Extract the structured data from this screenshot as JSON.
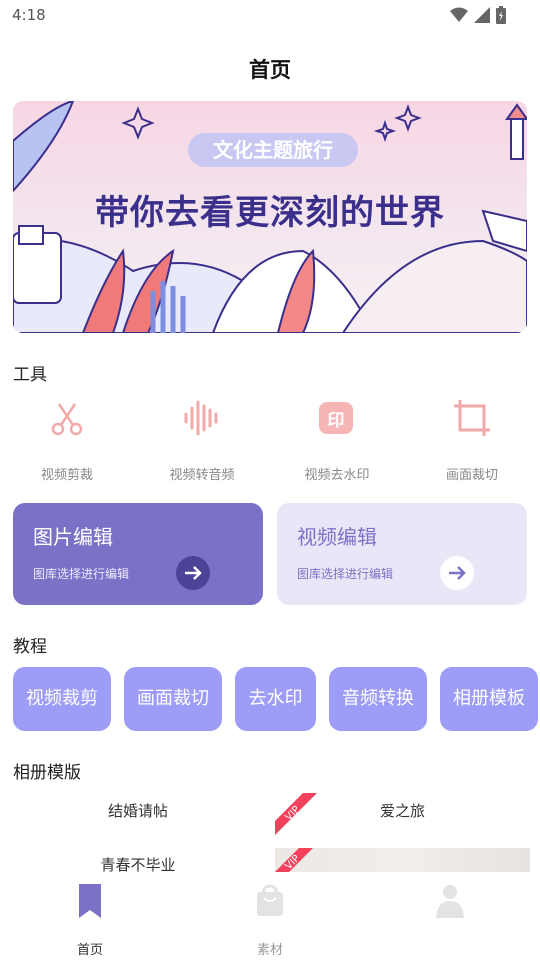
{
  "status_bar": {
    "time": "4:18",
    "icons": [
      "wifi-icon",
      "signal-icon",
      "battery-icon"
    ]
  },
  "header": {
    "title": "首页"
  },
  "banner": {
    "pill": "文化主题旅行",
    "title": "带你去看更深刻的世界"
  },
  "tools": {
    "title": "工具",
    "items": [
      {
        "label": "视频剪裁",
        "icon": "scissors-icon"
      },
      {
        "label": "视频转音频",
        "icon": "audio-wave-icon"
      },
      {
        "label": "视频去水印",
        "icon": "watermark-icon"
      },
      {
        "label": "画面裁切",
        "icon": "crop-icon"
      }
    ]
  },
  "cards": [
    {
      "title": "图片编辑",
      "subtitle": "图库选择进行编辑",
      "bg": "#7b72c8"
    },
    {
      "title": "视频编辑",
      "subtitle": "图库选择进行编辑",
      "bg": "#ebe6f7"
    }
  ],
  "tutorials": {
    "title": "教程",
    "chips": [
      "视频裁剪",
      "画面裁切",
      "去水印",
      "音频转换",
      "相册模板"
    ]
  },
  "albums": {
    "title": "相册模版",
    "items": [
      "结婚请帖",
      "爱之旅",
      "青春不毕业"
    ],
    "badge": "VIP"
  },
  "bottom_nav": {
    "items": [
      {
        "label": "首页",
        "icon": "bookmark-icon",
        "active": true
      },
      {
        "label": "素材",
        "icon": "bag-icon",
        "active": false
      },
      {
        "label": "",
        "icon": "person-icon",
        "active": false
      }
    ]
  },
  "colors": {
    "accent": "#7b72c8",
    "chip": "#9d9cf7",
    "tool_icon": "#f3a9a9"
  }
}
